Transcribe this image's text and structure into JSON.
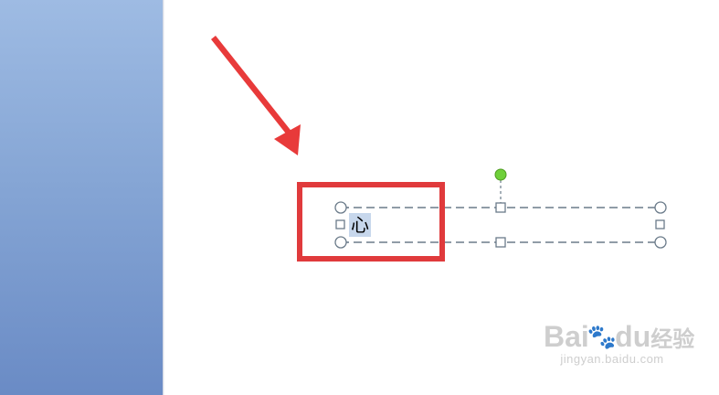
{
  "text_box": {
    "selected_text": "心"
  },
  "annotation": {
    "highlight_color": "#e03a3c",
    "arrow_color": "#e83a3a"
  },
  "panel": {
    "color": "#8aaad8"
  },
  "handles": {
    "rotation_color": "#6fd03a",
    "border_color": "#6b7b8a"
  },
  "watermark": {
    "brand_1": "Bai",
    "paw": "🐾",
    "brand_2": "du",
    "suffix": "经验",
    "url": "jingyan.baidu.com"
  }
}
